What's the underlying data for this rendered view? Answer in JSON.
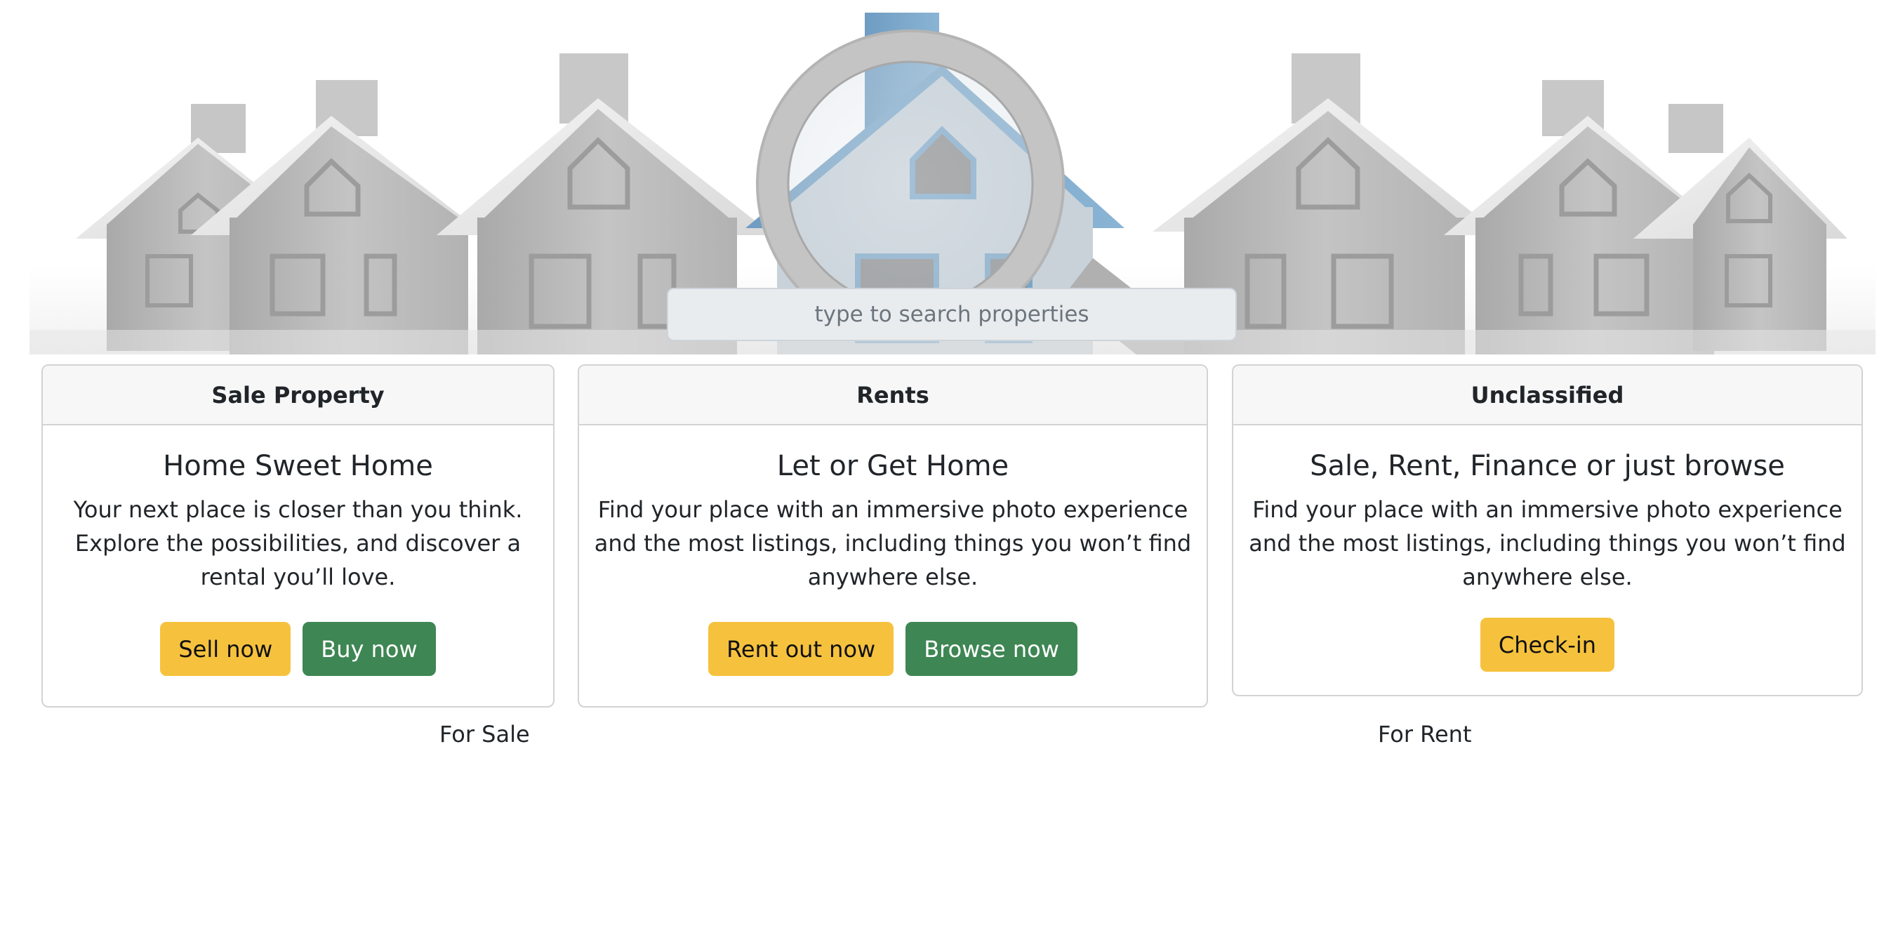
{
  "search": {
    "placeholder": "type to search properties"
  },
  "cards": [
    {
      "header": "Sale Property",
      "title": "Home Sweet Home",
      "text": "Your next place is closer than you think. Explore the possibilities, and discover a rental you’ll love.",
      "buttons": [
        {
          "label": "Sell now",
          "style": "warning"
        },
        {
          "label": "Buy now",
          "style": "success"
        }
      ]
    },
    {
      "header": "Rents",
      "title": "Let or Get Home",
      "text": "Find your place with an immersive photo experience and the most listings, including things you won’t find anywhere else.",
      "buttons": [
        {
          "label": "Rent out now",
          "style": "warning"
        },
        {
          "label": "Browse now",
          "style": "success"
        }
      ]
    },
    {
      "header": "Unclassified",
      "title": "Sale, Rent, Finance or just browse",
      "text": "Find your place with an immersive photo experience and the most listings, including things you won’t find anywhere else.",
      "buttons": [
        {
          "label": "Check-in",
          "style": "warning"
        }
      ]
    }
  ],
  "footer": {
    "left_label": "For Sale",
    "right_label": "For Rent"
  },
  "colors": {
    "warning": "#f6c23e",
    "success": "#3e8653",
    "house_gray": "#bdbdbd",
    "house_blue": "#7aa6c8"
  }
}
